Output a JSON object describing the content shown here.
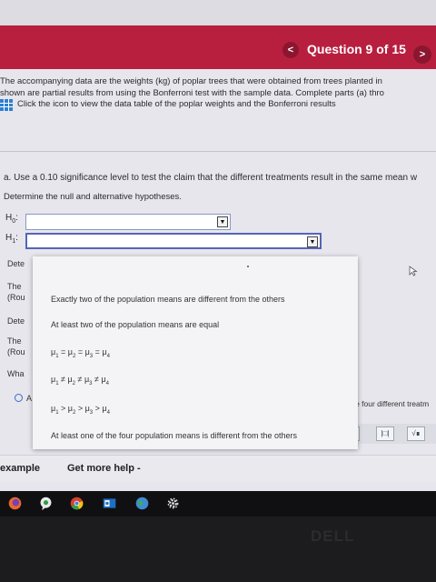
{
  "header": {
    "question_counter": "Question 9 of 15",
    "prev_icon": "chevron-left-icon",
    "next_icon": "chevron-right-icon",
    "prev_glyph": "<",
    "next_glyph": ">",
    "accent_color": "#b81f3f"
  },
  "intro": {
    "line1": "The accompanying data are the weights (kg) of poplar trees that were obtained from trees planted in",
    "line2": "shown are partial results from using the Bonferroni test with the sample data. Complete parts (a) thro",
    "link_text": "Click the icon to view the data table of the poplar weights and the Bonferroni results"
  },
  "part_a": {
    "question": "a. Use a 0.10 significance level to test the claim that the different treatments result in the same mean w",
    "instruction": "Determine the null and alternative hypotheses."
  },
  "hypotheses": {
    "h0_symbol": "H",
    "h0_sub": "0",
    "h0_colon": ":",
    "h1_symbol": "H",
    "h1_sub": "1",
    "h1_colon": ":",
    "dropdown_arrow": "▼"
  },
  "background_snippets": {
    "s1": "Dete",
    "s2": "The",
    "s3": "(Rou",
    "s4": "Dete",
    "s5": "The",
    "s6": "(Rou",
    "s7": "Wha",
    "s8": "A",
    "right_text": "the four different treatm"
  },
  "dropdown_options": {
    "o1": "Exactly two of the population means are different from the others",
    "o2": "At least two of the population means are equal",
    "o3_mu": "μ",
    "o3_sub1": "1",
    "o3_rel1": " = ",
    "o3_sub2": "2",
    "o3_rel2": " = ",
    "o3_sub3": "3",
    "o3_rel3": " = ",
    "o3_sub4": "4",
    "o4_mu": "μ",
    "o4_sub1": "1",
    "o4_rel1": " ≠ ",
    "o4_sub2": "2",
    "o4_rel2": " ≠ ",
    "o4_sub3": "3",
    "o4_rel3": " ≠ ",
    "o4_sub4": "4",
    "o5_mu": "μ",
    "o5_sub1": "1",
    "o5_rel1": " > ",
    "o5_sub2": "2",
    "o5_rel2": " > ",
    "o5_sub3": "3",
    "o5_rel3": " > ",
    "o5_sub4": "4",
    "o6": "At least one of the four population means is different from the others"
  },
  "toolbar": {
    "btn1": "·",
    "btn2": "|□|",
    "btn3": "√∎"
  },
  "bottom": {
    "example": "example",
    "get_more_help": "Get more help -"
  },
  "taskbar": {
    "icons": [
      "firefox-icon",
      "chat-icon",
      "chrome-icon",
      "outlook-icon",
      "globe-icon",
      "settings-icon"
    ]
  },
  "bezel": {
    "logo": "DELL"
  }
}
